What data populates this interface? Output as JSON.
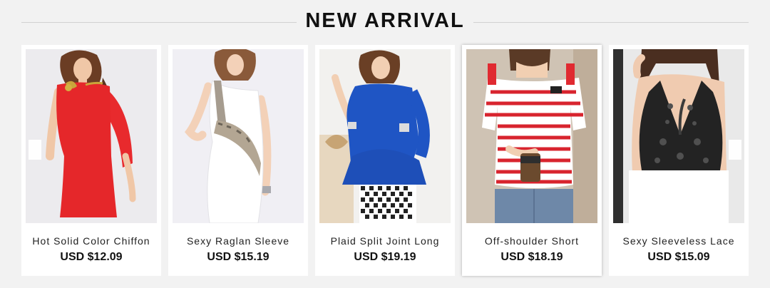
{
  "section": {
    "title": "NEW ARRIVAL"
  },
  "products": [
    {
      "name": "Hot Solid Color Chiffon",
      "price": "USD $12.09"
    },
    {
      "name": "Sexy Raglan Sleeve",
      "price": "USD $15.19"
    },
    {
      "name": "Plaid Split Joint Long",
      "price": "USD $19.19"
    },
    {
      "name": "Off-shoulder Short",
      "price": "USD $18.19"
    },
    {
      "name": "Sexy Sleeveless Lace",
      "price": "USD $15.09"
    }
  ],
  "colors": {
    "background": "#f2f2f2",
    "card": "#ffffff",
    "title": "#111111",
    "divider": "#d2d2d2"
  }
}
